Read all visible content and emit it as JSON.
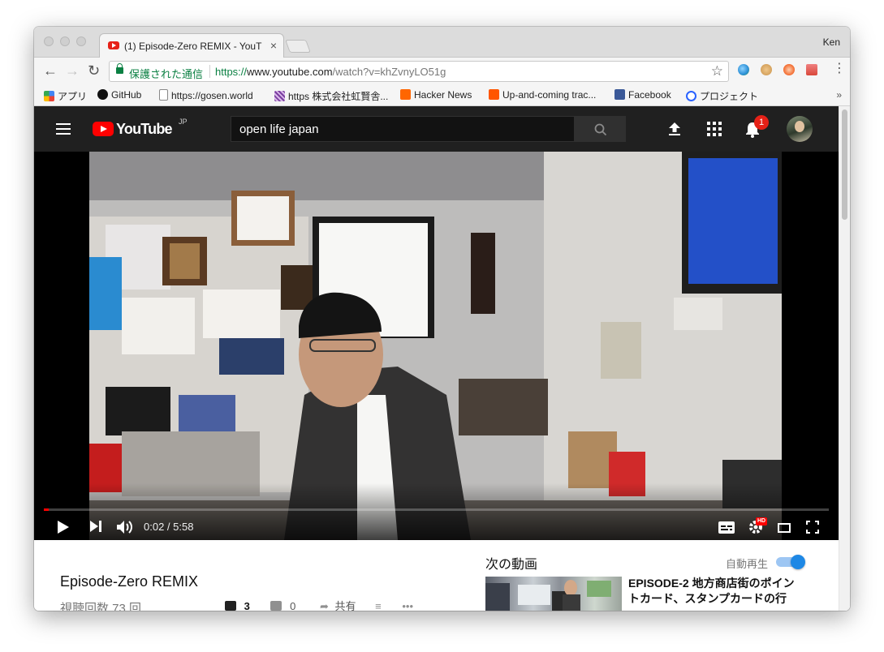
{
  "browser": {
    "tab_title": "(1) Episode-Zero REMIX - YouT",
    "tab_close": "×",
    "profile_name": "Ken",
    "nav": {
      "back": "←",
      "forward": "→",
      "reload": "↻"
    },
    "secure_label": "保護された通信",
    "url": {
      "scheme": "https://",
      "host": "www.youtube.com",
      "path": "/watch?v=khZvnyLO51g"
    },
    "star": "☆",
    "menu": "⋮"
  },
  "bookmarks": {
    "items": [
      {
        "label": "アプリ"
      },
      {
        "label": "GitHub"
      },
      {
        "label": "https://gosen.world"
      },
      {
        "label": "https 株式会社虹賢舎..."
      },
      {
        "label": "Hacker News"
      },
      {
        "label": "Up-and-coming trac..."
      },
      {
        "label": "Facebook"
      },
      {
        "label": "プロジェクト"
      }
    ],
    "more": "»"
  },
  "youtube": {
    "logo_text": "YouTube",
    "logo_region": "JP",
    "search_value": "open life japan",
    "notification_count": "1"
  },
  "player": {
    "time": "0:02 / 5:58",
    "progress_fraction": 0.006,
    "hd_badge": "HD"
  },
  "video": {
    "title": "Episode-Zero REMIX",
    "views": "視聴回数 73 回",
    "like_count": "3",
    "dislike_count": "0",
    "share_label": "共有"
  },
  "sidebar": {
    "up_next": "次の動画",
    "autoplay": "自動再生",
    "autoplay_on": true,
    "next_video_title": "EPISODE-2 地方商店街のポイントカード、スタンプカードの行"
  },
  "colors": {
    "accent_red": "#ff0000",
    "secure_green": "#0b8043",
    "toggle_blue": "#1e88e5",
    "header_dark": "#202020"
  }
}
